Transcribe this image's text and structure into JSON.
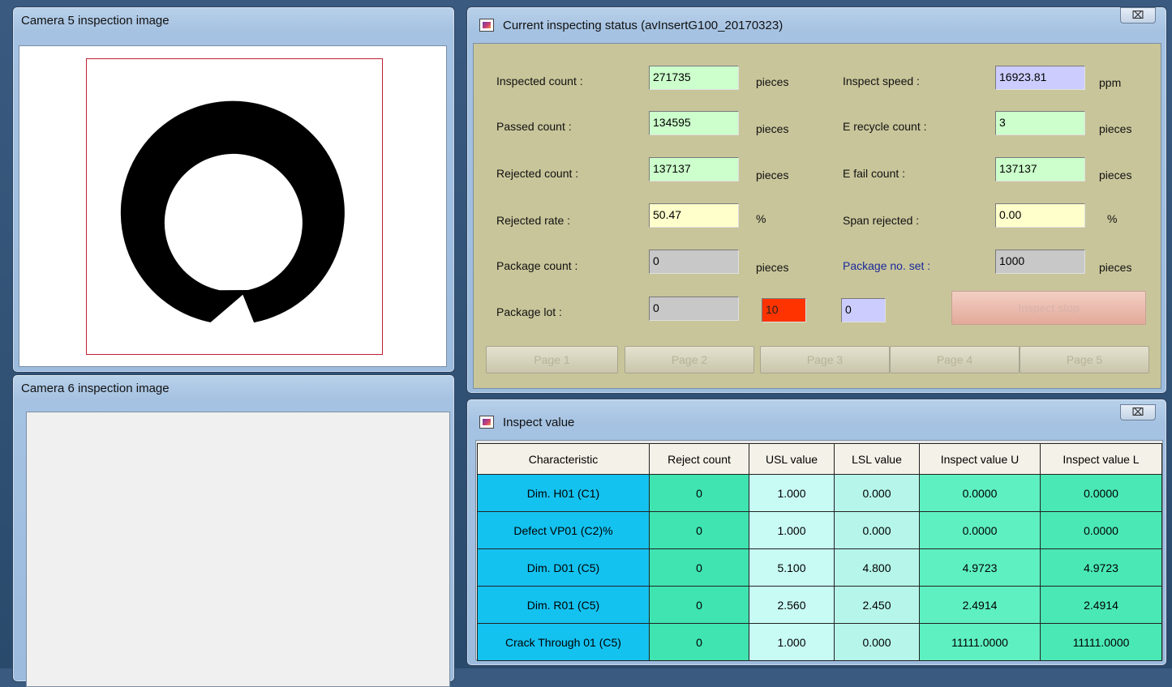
{
  "camera5": {
    "title": "Camera 5 inspection image"
  },
  "camera6": {
    "title": "Camera 6 inspection image"
  },
  "status_window": {
    "title": "Current inspecting status (avInsertG100_20170323)",
    "close_glyph": "⌧",
    "rows": [
      {
        "left_label": "Inspected count :",
        "left_value": "271735",
        "left_unit": "pieces",
        "right_label": "Inspect speed :",
        "right_value": "16923.81",
        "right_unit": "ppm"
      },
      {
        "left_label": "Passed count :",
        "left_value": "134595",
        "left_unit": "pieces",
        "right_label": "E recycle count :",
        "right_value": "3",
        "right_unit": "pieces"
      },
      {
        "left_label": "Rejected count :",
        "left_value": "137137",
        "left_unit": "pieces",
        "right_label": "E fail count :",
        "right_value": "137137",
        "right_unit": "pieces"
      },
      {
        "left_label": "Rejected rate :",
        "left_value": "50.47",
        "left_unit": "%",
        "right_label": "Span rejected :",
        "right_value": "0.00",
        "right_unit": "%"
      },
      {
        "left_label": "Package count :",
        "left_value": "0",
        "left_unit": "pieces",
        "right_label": "Package no. set :",
        "right_value": "1000",
        "right_unit": "pieces"
      }
    ],
    "package_lot": {
      "label": "Package lot :",
      "value1": "0",
      "value2": "10",
      "value3": "0"
    },
    "inspect_stop_label": "Inspect stop",
    "pages": [
      "Page 1",
      "Page 2",
      "Page 3",
      "Page 4",
      "Page 5"
    ],
    "colors": {
      "panel_bg": "#c8c59a",
      "green_field": "#ccffcc",
      "yellow_field": "#ffffcc",
      "gray_field": "#c8c8c8",
      "lavender_field": "#ccccff",
      "red_field": "#ff3300"
    }
  },
  "inspect_window": {
    "title": "Inspect value",
    "close_glyph": "⌧",
    "headers": [
      "Characteristic",
      "Reject count",
      "USL value",
      "LSL value",
      "Inspect value U",
      "Inspect value L"
    ],
    "rows": [
      [
        "Dim. H01 (C1)",
        "0",
        "1.000",
        "0.000",
        "0.0000",
        "0.0000"
      ],
      [
        "Defect VP01 (C2)%",
        "0",
        "1.000",
        "0.000",
        "0.0000",
        "0.0000"
      ],
      [
        "Dim. D01 (C5)",
        "0",
        "5.100",
        "4.800",
        "4.9723",
        "4.9723"
      ],
      [
        "Dim. R01 (C5)",
        "0",
        "2.560",
        "2.450",
        "2.4914",
        "2.4914"
      ],
      [
        "Crack Through 01 (C5)",
        "0",
        "1.000",
        "0.000",
        "11111.0000",
        "11111.0000"
      ]
    ]
  }
}
